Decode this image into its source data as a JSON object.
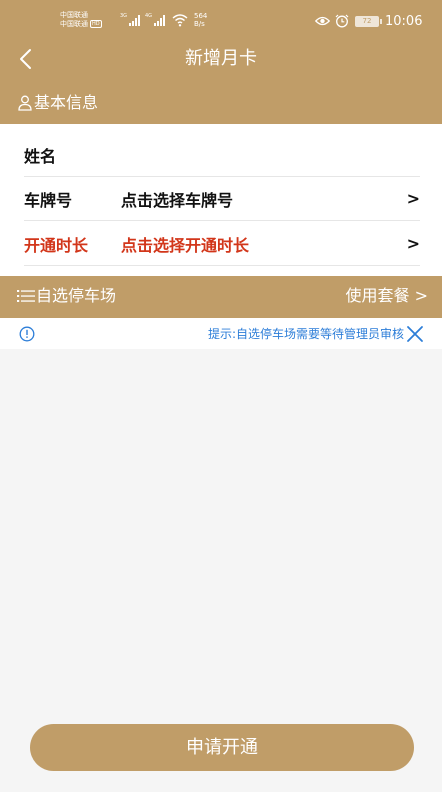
{
  "status_bar": {
    "carrier1": "中国联通",
    "carrier2": "中国联通",
    "hd_label": "HD",
    "sig1_label": "3G",
    "sig2_label": "4G",
    "speed_value": "564",
    "speed_unit": "B/s",
    "battery": "72",
    "time": "10:06"
  },
  "header": {
    "title": "新增月卡"
  },
  "basic_section": {
    "label": "基本信息"
  },
  "form": {
    "name_label": "姓名",
    "plate_label": "车牌号",
    "plate_value": "点击选择车牌号",
    "plate_arrow": ">",
    "duration_label": "开通时长",
    "duration_value": "点击选择开通时长",
    "duration_arrow": ">"
  },
  "parking_section": {
    "label": "自选停车场",
    "package_link": "使用套餐 >"
  },
  "notice": {
    "text": "提示:自选停车场需要等待管理员审核"
  },
  "submit_label": "申请开通",
  "colors": {
    "primary": "#c09d68",
    "alert_red": "#d2361a",
    "notice_blue": "#2d7ed8",
    "background": "#f5f5f5"
  },
  "icons": {
    "back": "chevron-left-icon",
    "basic": "person-icon",
    "parking": "list-icon",
    "notice": "info-icon",
    "close": "close-icon"
  }
}
